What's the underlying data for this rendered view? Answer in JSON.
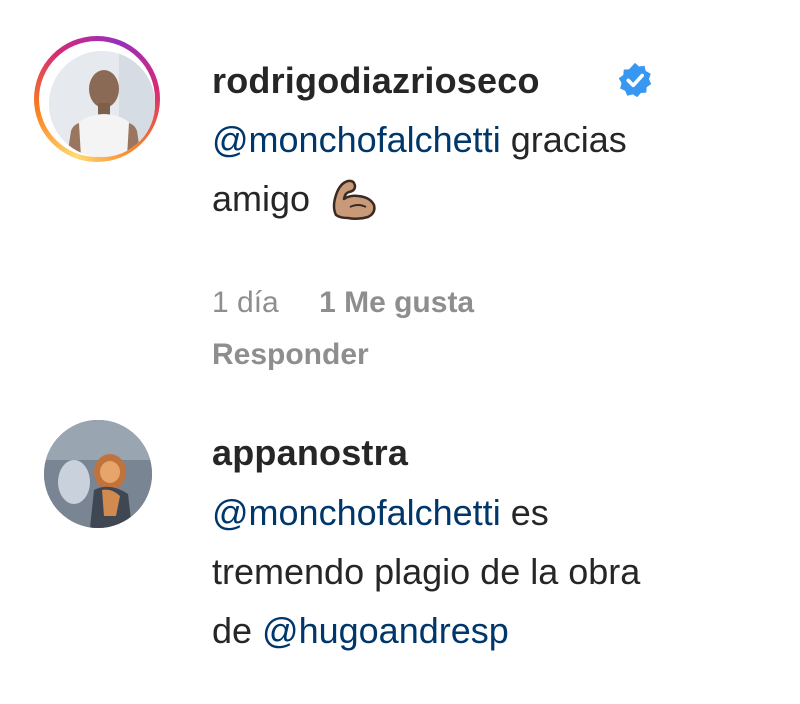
{
  "comments": [
    {
      "username": "rodrigodiazrioseco",
      "verified": true,
      "mention": "@monchofalchetti",
      "text_line1": " gracias",
      "text_line2": "amigo",
      "emoji": "flexed-biceps",
      "time": "1 día",
      "likes": "1 Me gusta",
      "reply_label": "Responder",
      "has_story_ring": true
    },
    {
      "username": "appanostra",
      "verified": false,
      "mention": "@monchofalchetti",
      "text_line1": " es",
      "text_line2": "tremendo plagio de la obra",
      "text_line3_prefix": "de ",
      "mention2": "@hugoandresp",
      "has_story_ring": false
    }
  ],
  "colors": {
    "text": "#262626",
    "mention": "#00376b",
    "muted": "#8e8e8e",
    "verified_badge": "#3897f0"
  }
}
